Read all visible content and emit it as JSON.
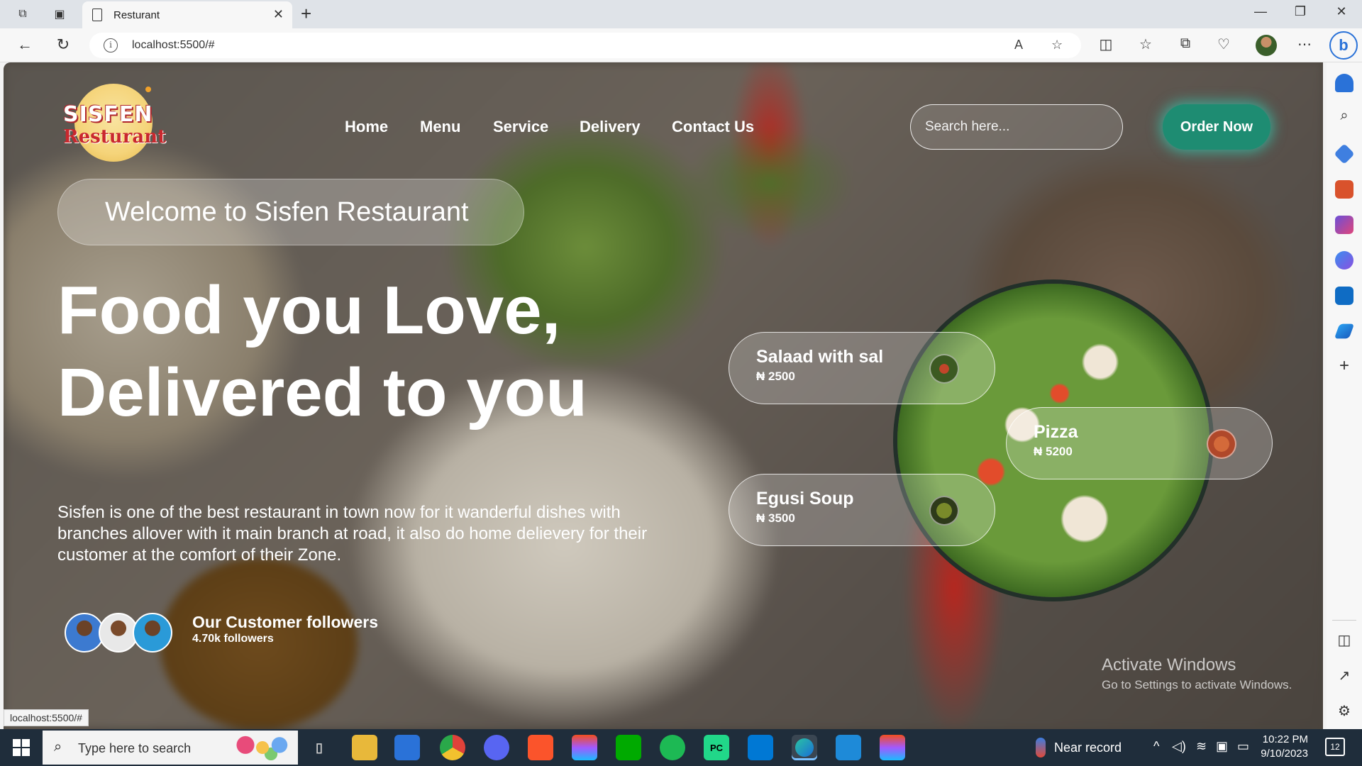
{
  "browser": {
    "tab_title": "Resturant",
    "url": "localhost:5500/#",
    "status_url": "localhost:5500/#"
  },
  "site": {
    "logo_top": "SISFEN",
    "logo_bottom": "Resturant",
    "nav": [
      "Home",
      "Menu",
      "Service",
      "Delivery",
      "Contact Us"
    ],
    "search_placeholder": "Search here...",
    "order_button": "Order Now",
    "welcome": "Welcome to Sisfen Restaurant",
    "hero_line1": "Food you Love,",
    "hero_line2": "Delivered to you",
    "description": "Sisfen is one of the best restaurant in town now for it wanderful dishes with branches allover with it main branch at road, it also do home delievery for their customer at the comfort of their Zone.",
    "followers_title": "Our Customer followers",
    "followers_count": "4.70k followers",
    "dishes": [
      {
        "name": "Salaad with sal",
        "price": "₦ 2500"
      },
      {
        "name": "Pizza",
        "price": "₦ 5200"
      },
      {
        "name": "Egusi Soup",
        "price": "₦ 3500"
      }
    ]
  },
  "watermark": {
    "line1": "Activate Windows",
    "line2": "Go to Settings to activate Windows."
  },
  "taskbar": {
    "search_text": "Type here to search",
    "weather": "Near record",
    "time": "10:22 PM",
    "date": "9/10/2023",
    "notification_count": "12"
  }
}
